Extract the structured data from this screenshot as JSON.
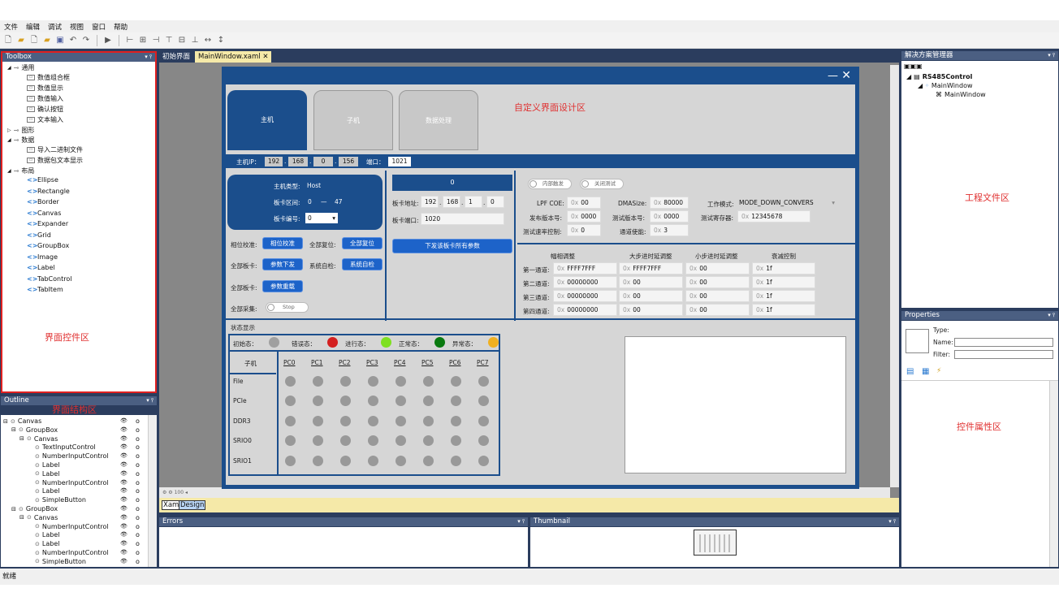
{
  "menu": [
    "文件",
    "编辑",
    "调试",
    "视图",
    "窗口",
    "帮助"
  ],
  "toolbox": {
    "title": "Toolbox",
    "groups": [
      {
        "label": "通用",
        "items": [
          "数值组合框",
          "数值显示",
          "数值输入",
          "确认按钮",
          "文本输入"
        ]
      },
      {
        "label": "图形",
        "items": []
      },
      {
        "label": "数据",
        "items": [
          "导入二进制文件",
          "数据包文本显示"
        ]
      },
      {
        "label": "布局",
        "items": [
          "Ellipse",
          "Rectangle",
          "Border",
          "Canvas",
          "Expander",
          "Grid",
          "GroupBox",
          "Image",
          "Label",
          "TabControl",
          "TabItem"
        ]
      }
    ],
    "region_label": "界面控件区"
  },
  "outline": {
    "title": "Outline",
    "region_label": "界面结构区",
    "rows": [
      {
        "text": "Canvas",
        "indent": 0
      },
      {
        "text": "GroupBox",
        "indent": 1
      },
      {
        "text": "Canvas",
        "indent": 2
      },
      {
        "text": "TextInputControl",
        "indent": 3
      },
      {
        "text": "NumberInputControl",
        "indent": 3
      },
      {
        "text": "Label",
        "indent": 3
      },
      {
        "text": "Label",
        "indent": 3
      },
      {
        "text": "NumberInputControl",
        "indent": 3
      },
      {
        "text": "Label",
        "indent": 3
      },
      {
        "text": "SimpleButton",
        "indent": 3
      },
      {
        "text": "GroupBox",
        "indent": 1
      },
      {
        "text": "Canvas",
        "indent": 2
      },
      {
        "text": "NumberInputControl",
        "indent": 3
      },
      {
        "text": "Label",
        "indent": 3
      },
      {
        "text": "Label",
        "indent": 3
      },
      {
        "text": "NumberInputControl",
        "indent": 3
      },
      {
        "text": "SimpleButton",
        "indent": 3
      }
    ]
  },
  "doc_tabs": [
    {
      "label": "初始界面"
    },
    {
      "label": "MainWindow.xaml ✕"
    }
  ],
  "design": {
    "region_label": "自定义界面设计区",
    "tabs": [
      "主机",
      "子机",
      "数据处理"
    ],
    "host_ip_label": "主机IP：",
    "host_ip": [
      "192",
      "168",
      "0",
      "156"
    ],
    "port_label": "端口：",
    "port": "1021",
    "host_type_label": "主机类型:",
    "host_type": "Host",
    "board_range_label": "板卡区间:",
    "board_range_from": "0",
    "board_range_sep": "—",
    "board_range_to": "47",
    "board_no_label": "板卡编号:",
    "board_no": "0",
    "phase_cal_label": "相位校准:",
    "phase_cal_btn": "相位校准",
    "reset_all_label": "全部复位:",
    "reset_all_btn": "全部复位",
    "all_board_label": "全部板卡:",
    "param_send_btn": "参数下发",
    "self_check_label": "系统自检:",
    "self_check_btn": "系统自检",
    "all_board_label2": "全部板卡:",
    "param_reload_btn": "参数重载",
    "all_collect_label": "全部采集:",
    "stop_toggle": "Stop",
    "mid_header": "0",
    "board_addr_label": "板卡地址:",
    "board_addr": [
      "192",
      "168",
      "1",
      "0"
    ],
    "board_port_label": "板卡端口:",
    "board_port": "1020",
    "send_all_btn": "下发该板卡所有参数",
    "toggle_internal": "内部触发",
    "toggle_close_test": "关闭测试",
    "lpf_label": "LPF COE:",
    "lpf": "00",
    "dma_label": "DMASize:",
    "dma": "80000",
    "mode_label": "工作模式:",
    "mode": "MODE_DOWN_CONVERS",
    "pub_ver_label": "发布版本号:",
    "pub_ver": "0000",
    "test_ver_label": "测试版本号:",
    "test_ver": "0000",
    "test_reg_label": "测试寄存器:",
    "test_reg": "12345678",
    "rate_ctrl_label": "测试速率控制:",
    "rate_ctrl": "0",
    "chan_en_label": "通道使能:",
    "chan_en": "3",
    "hex_prefix": "0x",
    "table_headers": [
      "幅相调整",
      "大步进时延调整",
      "小步进时延调整",
      "衰减控制"
    ],
    "table_rows": [
      {
        "label": "第一通道:",
        "vals": [
          "FFFF7FFF",
          "FFFF7FFF",
          "00",
          "1f"
        ]
      },
      {
        "label": "第二通道:",
        "vals": [
          "00000000",
          "00",
          "00",
          "1f"
        ]
      },
      {
        "label": "第三通道:",
        "vals": [
          "00000000",
          "00",
          "00",
          "1f"
        ]
      },
      {
        "label": "第四通道:",
        "vals": [
          "00000000",
          "00",
          "00",
          "1f"
        ]
      }
    ],
    "status_title": "状态显示",
    "legend": [
      {
        "label": "初始态：",
        "color": "#a0a0a0"
      },
      {
        "label": "错误态：",
        "color": "#d42020"
      },
      {
        "label": "进行态：",
        "color": "#7fe020"
      },
      {
        "label": "正常态：",
        "color": "#0a7a10"
      },
      {
        "label": "异常态：",
        "color": "#f0b020"
      }
    ],
    "grid_corner": "子机",
    "grid_cols": [
      "PC0",
      "PC1",
      "PC2",
      "PC3",
      "PC4",
      "PC5",
      "PC6",
      "PC7"
    ],
    "grid_rows": [
      "File",
      "PCIe",
      "DDR3",
      "SRIO0",
      "SRIO1"
    ]
  },
  "editor_bottom": {
    "zoom": "100",
    "tab_xaml": "Xaml",
    "tab_design": "Design"
  },
  "solution": {
    "title": "解决方案管理器",
    "root": "RS485Control",
    "items": [
      "MainWindow",
      "MainWindow"
    ],
    "region_label": "工程文件区"
  },
  "properties": {
    "title": "Properties",
    "type_label": "Type:",
    "name_label": "Name:",
    "filter_label": "Filter:",
    "region_label": "控件属性区"
  },
  "errors_title": "Errors",
  "thumbnail_title": "Thumbnail",
  "status_text": "就绪"
}
